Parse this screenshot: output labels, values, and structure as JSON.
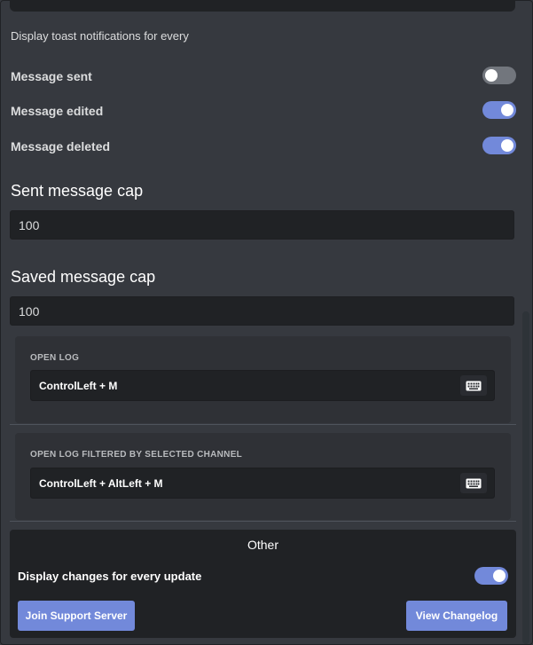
{
  "toast": {
    "section_label": "Display toast notifications for every",
    "items": [
      {
        "label": "Message sent",
        "state": "off"
      },
      {
        "label": "Message edited",
        "state": "on"
      },
      {
        "label": "Message deleted",
        "state": "on"
      }
    ]
  },
  "caps": {
    "sent_heading": "Sent message cap",
    "sent_value": "100",
    "saved_heading": "Saved message cap",
    "saved_value": "100"
  },
  "keybinds": [
    {
      "title": "OPEN LOG",
      "value": "ControlLeft + M",
      "icon": "keyboard-icon"
    },
    {
      "title": "OPEN LOG FILTERED BY SELECTED CHANNEL",
      "value": "ControlLeft + AltLeft + M",
      "icon": "keyboard-icon"
    }
  ],
  "other": {
    "title": "Other",
    "changes_label": "Display changes for every update",
    "changes_state": "on",
    "support_button": "Join Support Server",
    "changelog_button": "View Changelog"
  },
  "colors": {
    "accent": "#7289da",
    "toggle_off": "#72767d",
    "background": "#36393f",
    "input_bg": "#202225"
  }
}
